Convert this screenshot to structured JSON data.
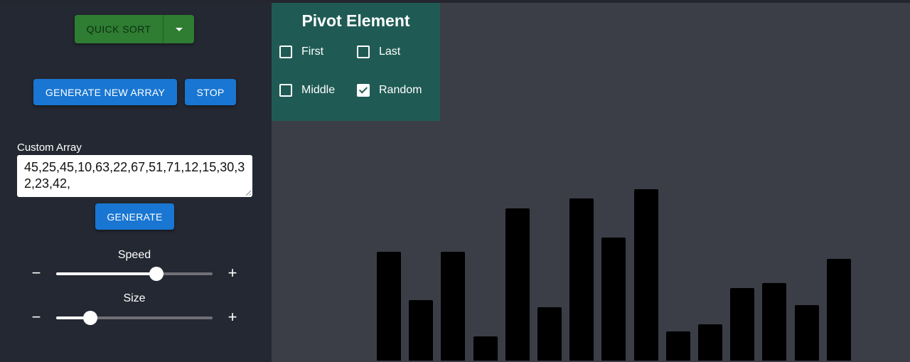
{
  "algorithm": {
    "selected": "QUICK SORT"
  },
  "buttons": {
    "generate_new_array": "GENERATE NEW ARRAY",
    "stop": "STOP",
    "generate": "GENERATE"
  },
  "custom_array": {
    "label": "Custom Array",
    "value": "45,25,45,10,63,22,67,51,71,12,15,30,32,23,42,"
  },
  "speed": {
    "label": "Speed",
    "minus": "−",
    "plus": "+",
    "level": 0.64
  },
  "size": {
    "label": "Size",
    "minus": "−",
    "plus": "+",
    "level": 0.22
  },
  "pivot": {
    "title": "Pivot Element",
    "options": [
      {
        "label": "First",
        "checked": false
      },
      {
        "label": "Last",
        "checked": false
      },
      {
        "label": "Middle",
        "checked": false
      },
      {
        "label": "Random",
        "checked": true
      }
    ]
  },
  "bars": {
    "values": [
      45,
      25,
      45,
      10,
      63,
      22,
      67,
      51,
      71,
      12,
      15,
      30,
      32,
      23,
      42
    ]
  },
  "colors": {
    "sidebar": "#242832",
    "canvas": "#3b3e47",
    "pivot_panel": "#1f5b54",
    "primary": "#1976d2",
    "success": "#2e7d32",
    "bar": "#000000"
  }
}
